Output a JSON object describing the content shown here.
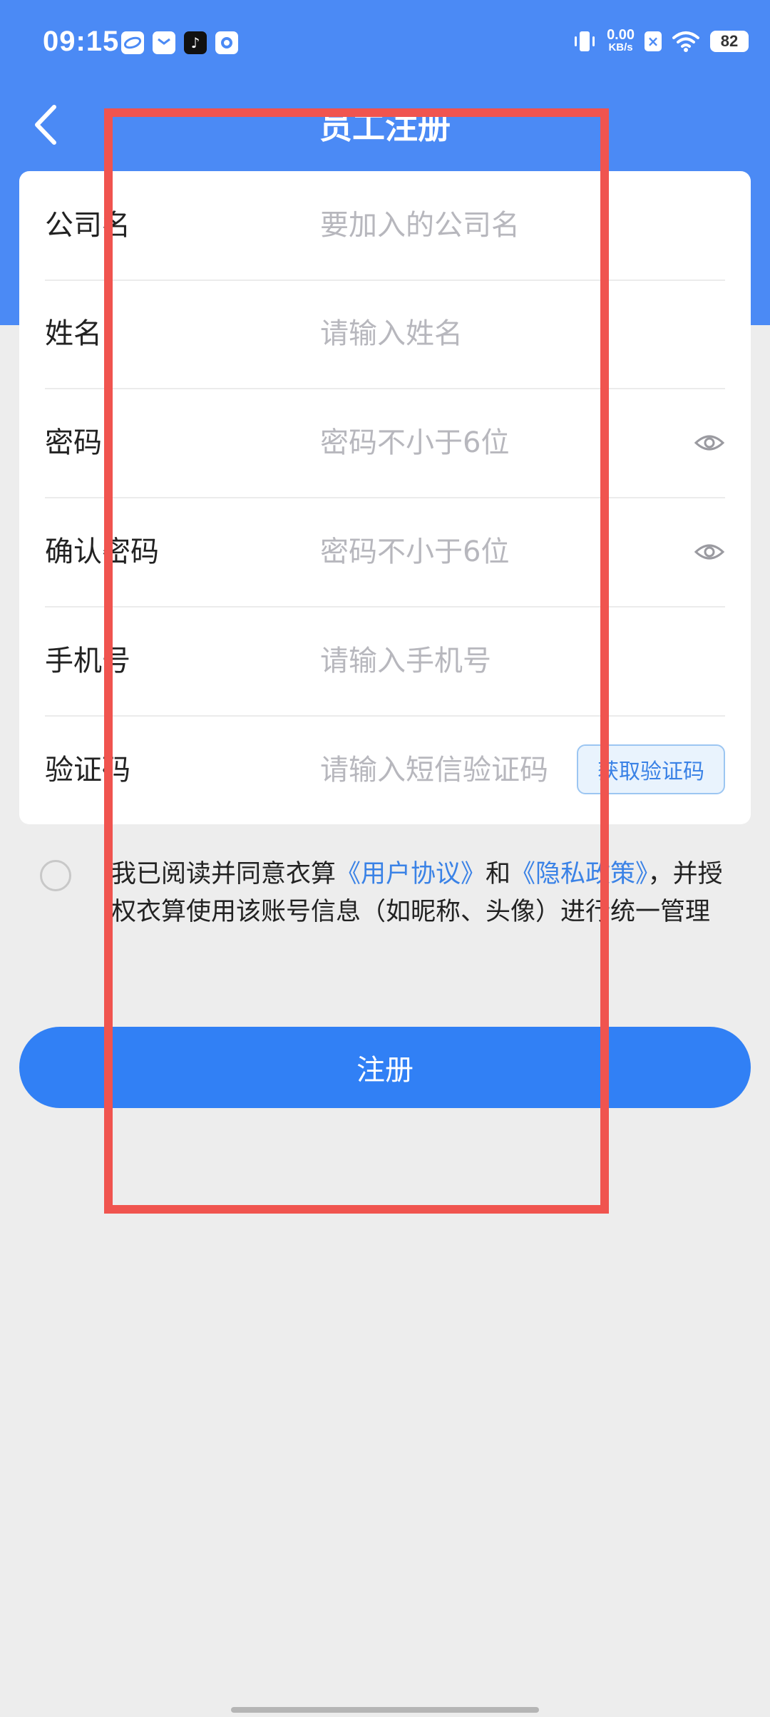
{
  "status_bar": {
    "time": "09:15",
    "net_speed_value": "0.00",
    "net_speed_unit": "KB/s",
    "battery": "82",
    "icons": [
      "cloud-icon",
      "mail-icon",
      "tiktok-icon",
      "camera-app-icon",
      "vibrate-icon",
      "no-sim-icon",
      "wifi-icon",
      "battery-icon"
    ]
  },
  "header": {
    "title": "员工注册",
    "back_icon": "chevron-left-icon"
  },
  "form": {
    "rows": [
      {
        "label": "公司名",
        "placeholder": "要加入的公司名"
      },
      {
        "label": "姓名",
        "placeholder": "请输入姓名"
      },
      {
        "label": "密码",
        "placeholder": "密码不小于6位",
        "icon": "eye-icon"
      },
      {
        "label": "确认密码",
        "placeholder": "密码不小于6位",
        "icon": "eye-icon"
      },
      {
        "label": "手机号",
        "placeholder": "请输入手机号"
      },
      {
        "label": "验证码",
        "placeholder": "请输入短信验证码",
        "button": "获取验证码"
      }
    ]
  },
  "agreement": {
    "prefix": "我已阅读并同意衣算",
    "user_agreement": "《用户协议》",
    "and": "和",
    "privacy_policy": "《隐私政策》",
    "suffix": "，并授权衣算使用该账号信息（如昵称、头像）进行统一管理"
  },
  "register_button": "注册",
  "colors": {
    "primary": "#3180f5",
    "header_bg": "#4b8af5",
    "link": "#3a82e6",
    "annotation": "#f0544f"
  }
}
